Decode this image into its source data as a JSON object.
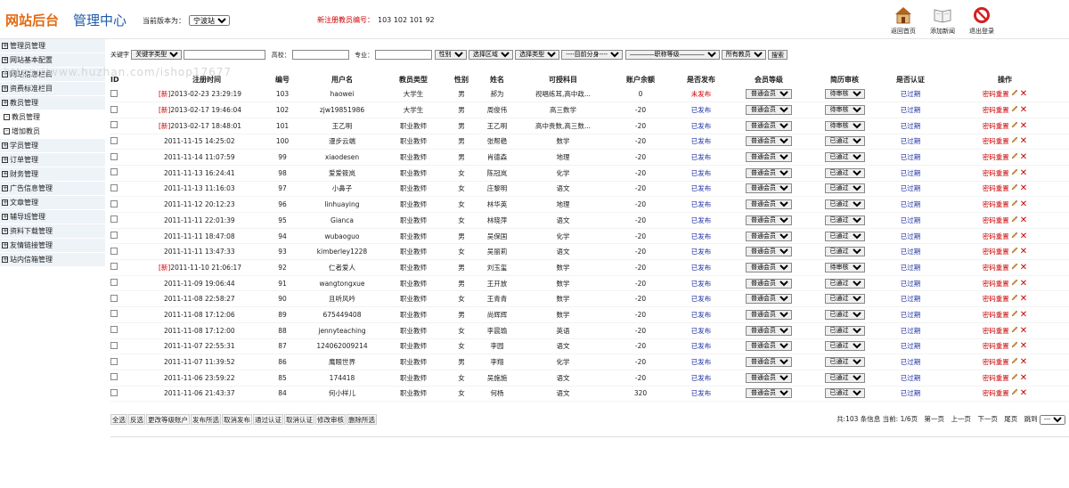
{
  "header": {
    "logo_main": "网站后台",
    "logo_sub": "管理中心",
    "version_label": "当前版本为：",
    "version_value": "宁波站",
    "new_reg_label": "新注册教员编号：",
    "new_reg_ids": "103  102  101  92",
    "buttons": [
      {
        "label": "返回首页",
        "icon": "home-icon"
      },
      {
        "label": "添加新闻",
        "icon": "book-icon"
      },
      {
        "label": "退出登录",
        "icon": "exit-icon"
      }
    ]
  },
  "sidebar": {
    "items": [
      {
        "label": "管理员管理",
        "sub": false
      },
      {
        "label": "网站基本配置",
        "sub": false
      },
      {
        "label": "网站信息栏目",
        "sub": false
      },
      {
        "label": "资费标准栏目",
        "sub": false
      },
      {
        "label": "教员管理",
        "sub": false
      },
      {
        "label": "教员管理",
        "sub": true
      },
      {
        "label": "增加教员",
        "sub": true
      },
      {
        "label": "学员管理",
        "sub": false
      },
      {
        "label": "订单管理",
        "sub": false
      },
      {
        "label": "财务管理",
        "sub": false
      },
      {
        "label": "广告信息管理",
        "sub": false
      },
      {
        "label": "文章管理",
        "sub": false
      },
      {
        "label": "辅导班管理",
        "sub": false
      },
      {
        "label": "资料下载管理",
        "sub": false
      },
      {
        "label": "友情链接管理",
        "sub": false
      },
      {
        "label": "站内信箱管理",
        "sub": false
      }
    ]
  },
  "watermark": "https://www.huzhan.com/ishop17677",
  "filter": {
    "keyword_label": "关键字",
    "keyword_type": "关键字类型",
    "school_label": "高校：",
    "major_label": "专业：",
    "gender": "性别",
    "region": "选择区域",
    "type": "选择类型",
    "identity": "----目前分身----",
    "level": "————职称等级————",
    "all_teachers": "所有教员",
    "search_button": "搜索"
  },
  "table": {
    "columns": [
      "ID",
      "注册时间",
      "编号",
      "用户名",
      "教员类型",
      "性别",
      "姓名",
      "可授科目",
      "账户余额",
      "是否发布",
      "会员等级",
      "简历审核",
      "是否认证",
      "操作"
    ],
    "rows": [
      {
        "new": true,
        "time": "2013-02-23 23:29:19",
        "id": "103",
        "user": "haowei",
        "type": "大学生",
        "gender": "男",
        "name": "郝为",
        "subject": "视唱练耳,高中政...",
        "balance": "0",
        "publish": "未发布",
        "level": "普通会员",
        "review": "待审核",
        "cert": "已过期"
      },
      {
        "new": true,
        "time": "2013-02-17 19:46:04",
        "id": "102",
        "user": "zjw19851986",
        "type": "大学生",
        "gender": "男",
        "name": "周俊伟",
        "subject": "高三数学",
        "balance": "-20",
        "publish": "已发布",
        "level": "普通会员",
        "review": "待审核",
        "cert": "已过期"
      },
      {
        "new": true,
        "time": "2013-02-17 18:48:01",
        "id": "101",
        "user": "王乙明",
        "type": "职业教师",
        "gender": "男",
        "name": "王乙明",
        "subject": "高中贵数,高三数...",
        "balance": "-20",
        "publish": "已发布",
        "level": "普通会员",
        "review": "待审核",
        "cert": "已过期"
      },
      {
        "new": false,
        "time": "2011-11-15 14:25:02",
        "id": "100",
        "user": "漫步云端",
        "type": "职业教师",
        "gender": "男",
        "name": "张帮稳",
        "subject": "数学",
        "balance": "-20",
        "publish": "已发布",
        "level": "普通会员",
        "review": "已通过",
        "cert": "已过期"
      },
      {
        "new": false,
        "time": "2011-11-14 11:07:59",
        "id": "99",
        "user": "xiaodesen",
        "type": "职业教师",
        "gender": "男",
        "name": "肖德森",
        "subject": "地理",
        "balance": "-20",
        "publish": "已发布",
        "level": "普通会员",
        "review": "已通过",
        "cert": "已过期"
      },
      {
        "new": false,
        "time": "2011-11-13 16:24:41",
        "id": "98",
        "user": "爱爱筱岚",
        "type": "职业教师",
        "gender": "女",
        "name": "陈冠岚",
        "subject": "化学",
        "balance": "-20",
        "publish": "已发布",
        "level": "普通会员",
        "review": "已通过",
        "cert": "已过期"
      },
      {
        "new": false,
        "time": "2011-11-13 11:16:03",
        "id": "97",
        "user": "小鼻子",
        "type": "职业教师",
        "gender": "女",
        "name": "庄黎明",
        "subject": "语文",
        "balance": "-20",
        "publish": "已发布",
        "level": "普通会员",
        "review": "已通过",
        "cert": "已过期"
      },
      {
        "new": false,
        "time": "2011-11-12 20:12:23",
        "id": "96",
        "user": "linhuaying",
        "type": "职业教师",
        "gender": "女",
        "name": "林华英",
        "subject": "地理",
        "balance": "-20",
        "publish": "已发布",
        "level": "普通会员",
        "review": "已通过",
        "cert": "已过期"
      },
      {
        "new": false,
        "time": "2011-11-11 22:01:39",
        "id": "95",
        "user": "Gianca",
        "type": "职业教师",
        "gender": "女",
        "name": "林晓萍",
        "subject": "语文",
        "balance": "-20",
        "publish": "已发布",
        "level": "普通会员",
        "review": "已通过",
        "cert": "已过期"
      },
      {
        "new": false,
        "time": "2011-11-11 18:47:08",
        "id": "94",
        "user": "wubaoguo",
        "type": "职业教师",
        "gender": "男",
        "name": "吴保国",
        "subject": "化学",
        "balance": "-20",
        "publish": "已发布",
        "level": "普通会员",
        "review": "已通过",
        "cert": "已过期"
      },
      {
        "new": false,
        "time": "2011-11-11 13:47:33",
        "id": "93",
        "user": "kimberley1228",
        "type": "职业教师",
        "gender": "女",
        "name": "吴丽莉",
        "subject": "语文",
        "balance": "-20",
        "publish": "已发布",
        "level": "普通会员",
        "review": "已通过",
        "cert": "已过期"
      },
      {
        "new": true,
        "time": "2011-11-10 21:06:17",
        "id": "92",
        "user": "仁者爱人",
        "type": "职业教师",
        "gender": "男",
        "name": "刘玉玺",
        "subject": "数学",
        "balance": "-20",
        "publish": "已发布",
        "level": "普通会员",
        "review": "待审核",
        "cert": "已过期"
      },
      {
        "new": false,
        "time": "2011-11-09 19:06:44",
        "id": "91",
        "user": "wangtongxue",
        "type": "职业教师",
        "gender": "男",
        "name": "王开放",
        "subject": "数学",
        "balance": "-20",
        "publish": "已发布",
        "level": "普通会员",
        "review": "已通过",
        "cert": "已过期"
      },
      {
        "new": false,
        "time": "2011-11-08 22:58:27",
        "id": "90",
        "user": "且听风吟",
        "type": "职业教师",
        "gender": "女",
        "name": "王青青",
        "subject": "数学",
        "balance": "-20",
        "publish": "已发布",
        "level": "普通会员",
        "review": "已通过",
        "cert": "已过期"
      },
      {
        "new": false,
        "time": "2011-11-08 17:12:06",
        "id": "89",
        "user": "675449408",
        "type": "职业教师",
        "gender": "男",
        "name": "尚辉辉",
        "subject": "数学",
        "balance": "-20",
        "publish": "已发布",
        "level": "普通会员",
        "review": "已通过",
        "cert": "已过期"
      },
      {
        "new": false,
        "time": "2011-11-08 17:12:00",
        "id": "88",
        "user": "jennyteaching",
        "type": "职业教师",
        "gender": "女",
        "name": "李晨瑜",
        "subject": "英语",
        "balance": "-20",
        "publish": "已发布",
        "level": "普通会员",
        "review": "已通过",
        "cert": "已过期"
      },
      {
        "new": false,
        "time": "2011-11-07 22:55:31",
        "id": "87",
        "user": "124062009214",
        "type": "职业教师",
        "gender": "女",
        "name": "李园",
        "subject": "语文",
        "balance": "-20",
        "publish": "已发布",
        "level": "普通会员",
        "review": "已通过",
        "cert": "已过期"
      },
      {
        "new": false,
        "time": "2011-11-07 11:39:52",
        "id": "86",
        "user": "鹰眼世界",
        "type": "职业教师",
        "gender": "男",
        "name": "李翔",
        "subject": "化学",
        "balance": "-20",
        "publish": "已发布",
        "level": "普通会员",
        "review": "已通过",
        "cert": "已过期"
      },
      {
        "new": false,
        "time": "2011-11-06 23:59:22",
        "id": "85",
        "user": "174418",
        "type": "职业教师",
        "gender": "女",
        "name": "吴施施",
        "subject": "语文",
        "balance": "-20",
        "publish": "已发布",
        "level": "普通会员",
        "review": "已通过",
        "cert": "已过期"
      },
      {
        "new": false,
        "time": "2011-11-06 21:43:37",
        "id": "84",
        "user": "何小样儿",
        "type": "职业教师",
        "gender": "女",
        "name": "何杨",
        "subject": "语文",
        "balance": "320",
        "publish": "已发布",
        "level": "普通会员",
        "review": "已通过",
        "cert": "已过期"
      }
    ],
    "new_tag": "[新]",
    "pwd_reset": "密码重置",
    "delete_symbol": "✕"
  },
  "bottom": {
    "actions": [
      "全选",
      "反选",
      "更改等级账户",
      "发布所选",
      "取消发布",
      "通过认证",
      "取消认证",
      "修改审核",
      "删除所选"
    ],
    "pager_info": "共:103 条信息 当前: 1/6页",
    "first": "第一页",
    "prev": "上一页",
    "next": "下一页",
    "last": "尾页",
    "jump": "跳到",
    "jump_value": "---"
  }
}
